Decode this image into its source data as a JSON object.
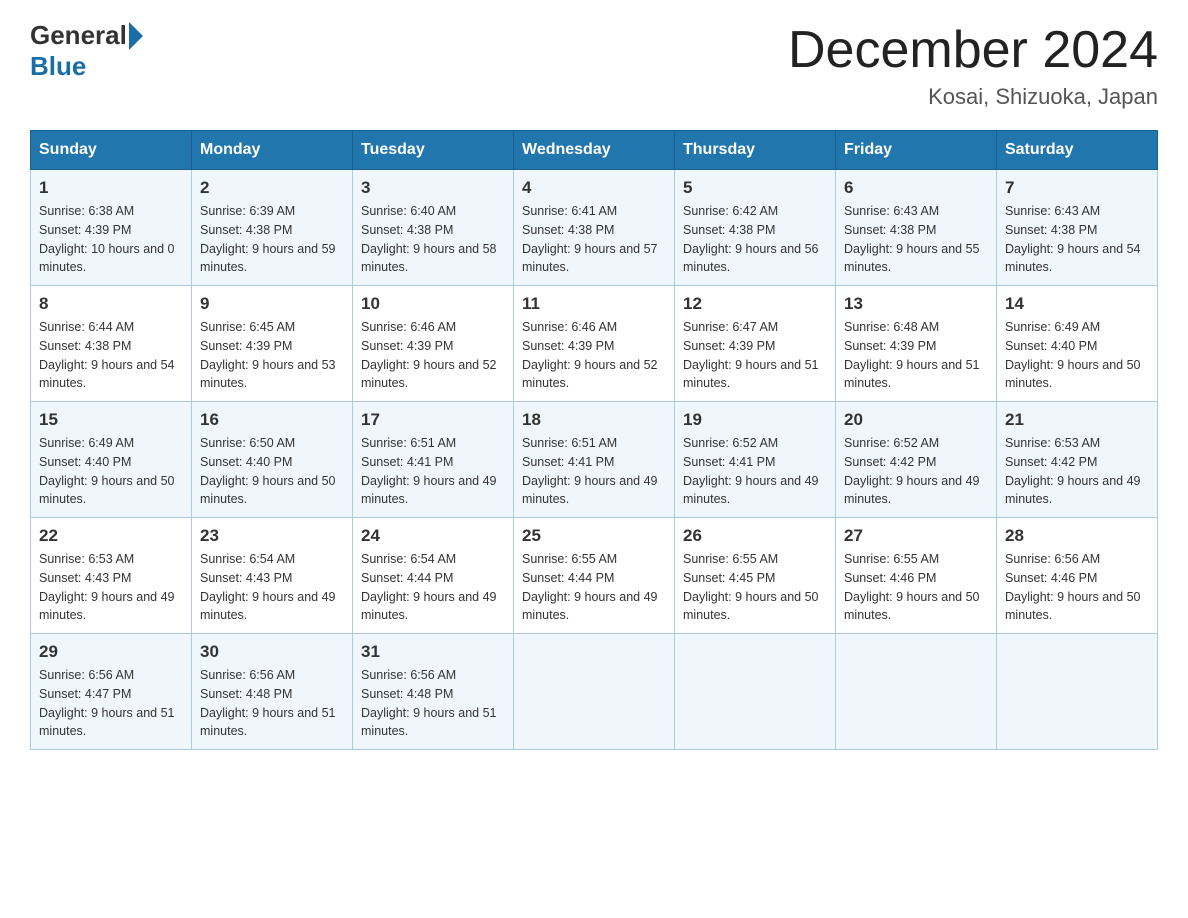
{
  "header": {
    "logo_general": "General",
    "logo_blue": "Blue",
    "month_title": "December 2024",
    "location": "Kosai, Shizuoka, Japan"
  },
  "weekdays": [
    "Sunday",
    "Monday",
    "Tuesday",
    "Wednesday",
    "Thursday",
    "Friday",
    "Saturday"
  ],
  "weeks": [
    [
      {
        "day": "1",
        "sunrise": "6:38 AM",
        "sunset": "4:39 PM",
        "daylight": "10 hours and 0 minutes."
      },
      {
        "day": "2",
        "sunrise": "6:39 AM",
        "sunset": "4:38 PM",
        "daylight": "9 hours and 59 minutes."
      },
      {
        "day": "3",
        "sunrise": "6:40 AM",
        "sunset": "4:38 PM",
        "daylight": "9 hours and 58 minutes."
      },
      {
        "day": "4",
        "sunrise": "6:41 AM",
        "sunset": "4:38 PM",
        "daylight": "9 hours and 57 minutes."
      },
      {
        "day": "5",
        "sunrise": "6:42 AM",
        "sunset": "4:38 PM",
        "daylight": "9 hours and 56 minutes."
      },
      {
        "day": "6",
        "sunrise": "6:43 AM",
        "sunset": "4:38 PM",
        "daylight": "9 hours and 55 minutes."
      },
      {
        "day": "7",
        "sunrise": "6:43 AM",
        "sunset": "4:38 PM",
        "daylight": "9 hours and 54 minutes."
      }
    ],
    [
      {
        "day": "8",
        "sunrise": "6:44 AM",
        "sunset": "4:38 PM",
        "daylight": "9 hours and 54 minutes."
      },
      {
        "day": "9",
        "sunrise": "6:45 AM",
        "sunset": "4:39 PM",
        "daylight": "9 hours and 53 minutes."
      },
      {
        "day": "10",
        "sunrise": "6:46 AM",
        "sunset": "4:39 PM",
        "daylight": "9 hours and 52 minutes."
      },
      {
        "day": "11",
        "sunrise": "6:46 AM",
        "sunset": "4:39 PM",
        "daylight": "9 hours and 52 minutes."
      },
      {
        "day": "12",
        "sunrise": "6:47 AM",
        "sunset": "4:39 PM",
        "daylight": "9 hours and 51 minutes."
      },
      {
        "day": "13",
        "sunrise": "6:48 AM",
        "sunset": "4:39 PM",
        "daylight": "9 hours and 51 minutes."
      },
      {
        "day": "14",
        "sunrise": "6:49 AM",
        "sunset": "4:40 PM",
        "daylight": "9 hours and 50 minutes."
      }
    ],
    [
      {
        "day": "15",
        "sunrise": "6:49 AM",
        "sunset": "4:40 PM",
        "daylight": "9 hours and 50 minutes."
      },
      {
        "day": "16",
        "sunrise": "6:50 AM",
        "sunset": "4:40 PM",
        "daylight": "9 hours and 50 minutes."
      },
      {
        "day": "17",
        "sunrise": "6:51 AM",
        "sunset": "4:41 PM",
        "daylight": "9 hours and 49 minutes."
      },
      {
        "day": "18",
        "sunrise": "6:51 AM",
        "sunset": "4:41 PM",
        "daylight": "9 hours and 49 minutes."
      },
      {
        "day": "19",
        "sunrise": "6:52 AM",
        "sunset": "4:41 PM",
        "daylight": "9 hours and 49 minutes."
      },
      {
        "day": "20",
        "sunrise": "6:52 AM",
        "sunset": "4:42 PM",
        "daylight": "9 hours and 49 minutes."
      },
      {
        "day": "21",
        "sunrise": "6:53 AM",
        "sunset": "4:42 PM",
        "daylight": "9 hours and 49 minutes."
      }
    ],
    [
      {
        "day": "22",
        "sunrise": "6:53 AM",
        "sunset": "4:43 PM",
        "daylight": "9 hours and 49 minutes."
      },
      {
        "day": "23",
        "sunrise": "6:54 AM",
        "sunset": "4:43 PM",
        "daylight": "9 hours and 49 minutes."
      },
      {
        "day": "24",
        "sunrise": "6:54 AM",
        "sunset": "4:44 PM",
        "daylight": "9 hours and 49 minutes."
      },
      {
        "day": "25",
        "sunrise": "6:55 AM",
        "sunset": "4:44 PM",
        "daylight": "9 hours and 49 minutes."
      },
      {
        "day": "26",
        "sunrise": "6:55 AM",
        "sunset": "4:45 PM",
        "daylight": "9 hours and 50 minutes."
      },
      {
        "day": "27",
        "sunrise": "6:55 AM",
        "sunset": "4:46 PM",
        "daylight": "9 hours and 50 minutes."
      },
      {
        "day": "28",
        "sunrise": "6:56 AM",
        "sunset": "4:46 PM",
        "daylight": "9 hours and 50 minutes."
      }
    ],
    [
      {
        "day": "29",
        "sunrise": "6:56 AM",
        "sunset": "4:47 PM",
        "daylight": "9 hours and 51 minutes."
      },
      {
        "day": "30",
        "sunrise": "6:56 AM",
        "sunset": "4:48 PM",
        "daylight": "9 hours and 51 minutes."
      },
      {
        "day": "31",
        "sunrise": "6:56 AM",
        "sunset": "4:48 PM",
        "daylight": "9 hours and 51 minutes."
      },
      {
        "day": "",
        "sunrise": "",
        "sunset": "",
        "daylight": ""
      },
      {
        "day": "",
        "sunrise": "",
        "sunset": "",
        "daylight": ""
      },
      {
        "day": "",
        "sunrise": "",
        "sunset": "",
        "daylight": ""
      },
      {
        "day": "",
        "sunrise": "",
        "sunset": "",
        "daylight": ""
      }
    ]
  ]
}
